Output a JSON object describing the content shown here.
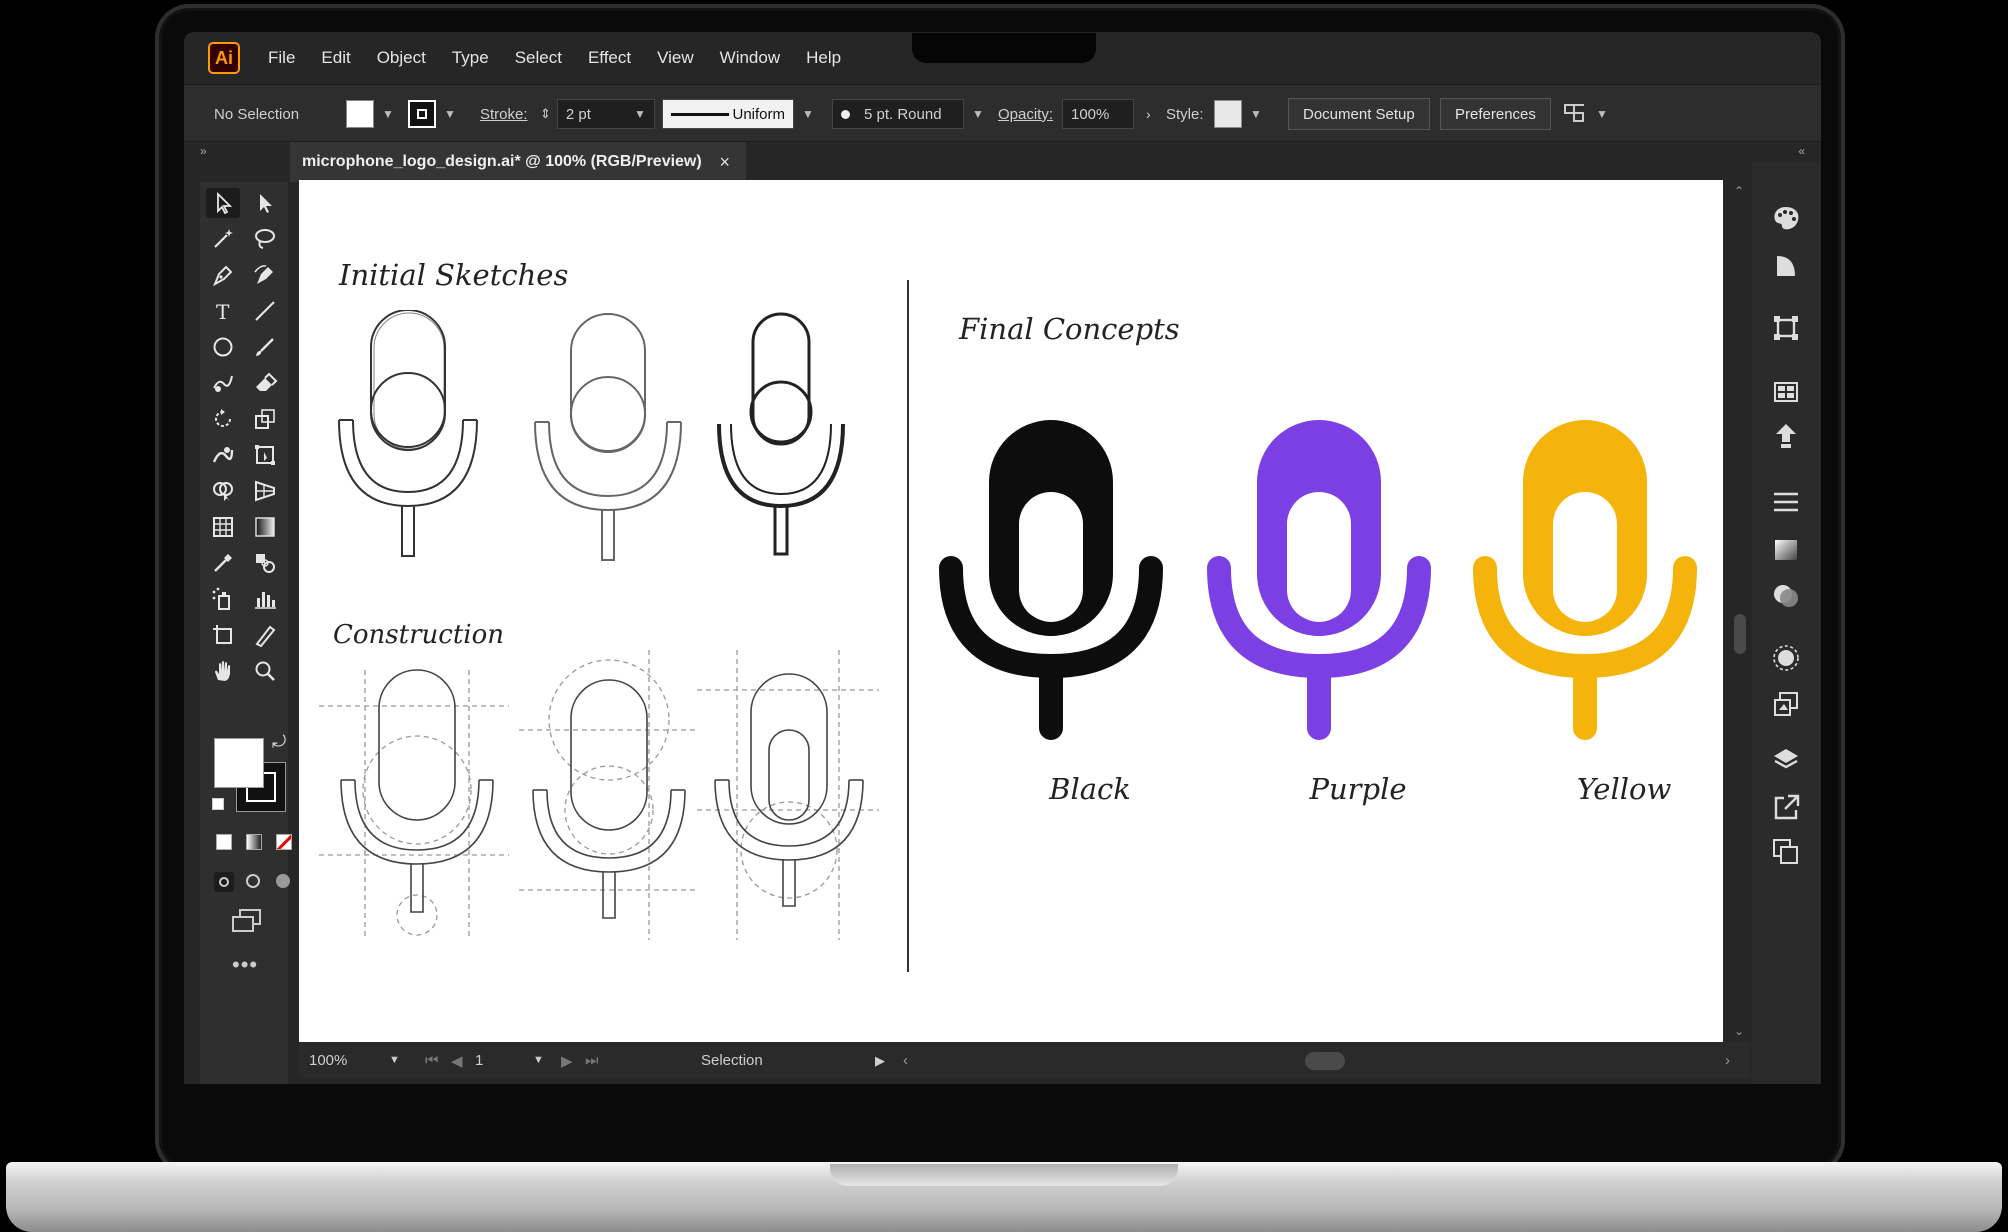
{
  "app": {
    "logo_text": "Ai",
    "accent": "#ff9a00"
  },
  "menu": [
    "File",
    "Edit",
    "Object",
    "Type",
    "Select",
    "Effect",
    "View",
    "Window",
    "Help"
  ],
  "control_bar": {
    "selection_label": "No Selection",
    "stroke_label": "Stroke:",
    "stroke_weight": "2 pt",
    "profile": "Uniform",
    "brush": "5 pt. Round",
    "opacity_label": "Opacity:",
    "opacity_value": "100%",
    "style_label": "Style:",
    "document_setup": "Document Setup",
    "preferences": "Preferences"
  },
  "document_tab": {
    "title": "microphone_logo_design.ai* @ 100% (RGB/Preview)",
    "close": "×"
  },
  "artboard": {
    "initial_sketches": "Initial  Sketches",
    "construction": "Construction",
    "final_concepts": "Final  Concepts",
    "concepts": [
      {
        "label": "Black",
        "color": "#0d0d0d"
      },
      {
        "label": "Purple",
        "color": "#7b3fe4"
      },
      {
        "label": "Yellow",
        "color": "#f5b40b"
      }
    ]
  },
  "status_bar": {
    "zoom": "100%",
    "artboard_number": "1",
    "tool": "Selection"
  },
  "icons": [
    "selection-tool-icon",
    "direct-selection-tool-icon",
    "magic-wand-icon",
    "lasso-icon",
    "pen-tool-icon",
    "curvature-tool-icon",
    "type-tool-icon",
    "line-tool-icon",
    "ellipse-tool-icon",
    "paintbrush-icon",
    "shaper-tool-icon",
    "eraser-icon",
    "rotate-tool-icon",
    "scale-tool-icon",
    "warp-tool-icon",
    "free-transform-icon",
    "shape-builder-icon",
    "perspective-grid-icon",
    "mesh-tool-icon",
    "gradient-tool-icon",
    "eyedropper-icon",
    "blend-tool-icon",
    "symbol-sprayer-icon",
    "column-graph-icon",
    "artboard-tool-icon",
    "slice-tool-icon",
    "hand-tool-icon",
    "zoom-tool-icon"
  ]
}
